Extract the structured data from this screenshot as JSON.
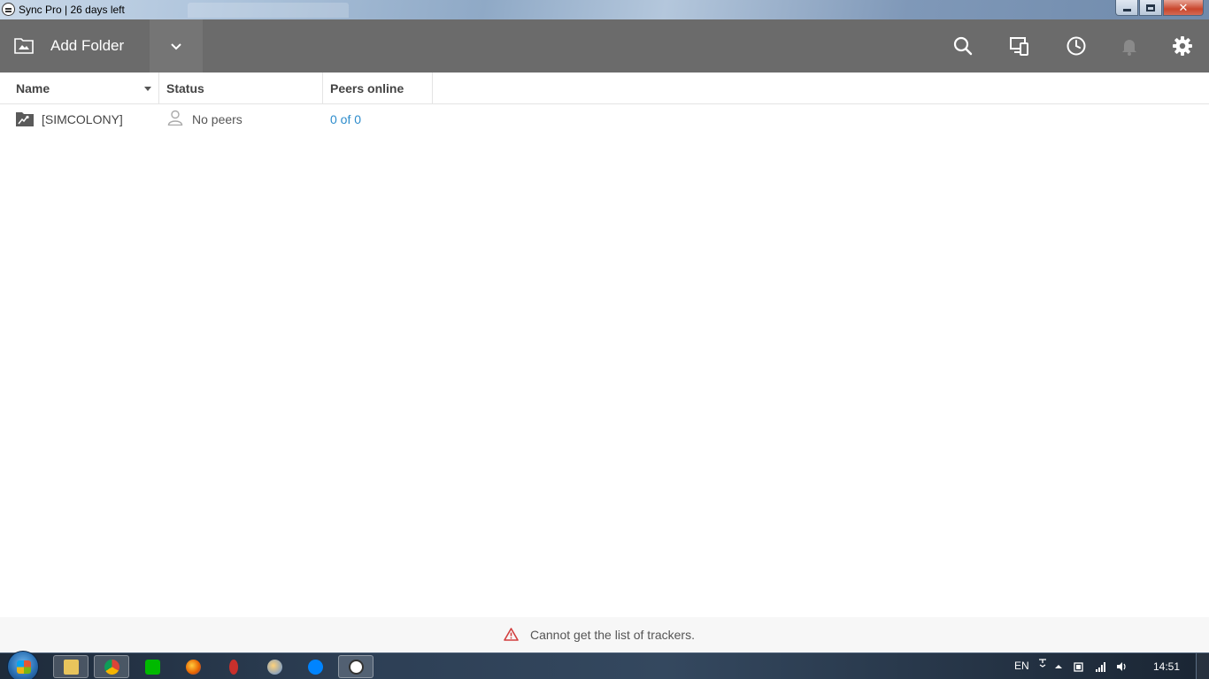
{
  "window": {
    "title": "Sync Pro | 26 days left"
  },
  "toolbar": {
    "add_folder_label": "Add Folder",
    "icons": [
      "search-icon",
      "devices-icon",
      "history-icon",
      "notifications-icon",
      "settings-icon"
    ]
  },
  "table": {
    "columns": [
      "Name",
      "Status",
      "Peers online"
    ],
    "sort_column": "Name",
    "rows": [
      {
        "name": "[SIMCOLONY]",
        "status": "No peers",
        "peers_online": "0 of 0"
      }
    ]
  },
  "statusbar": {
    "message": "Cannot get the list of trackers."
  },
  "taskbar": {
    "apps": [
      "file-explorer-icon",
      "chrome-icon",
      "chat-app-icon",
      "firefox-icon",
      "utility-app-icon",
      "browser-app-icon",
      "messenger-icon",
      "sync-app-icon"
    ],
    "language": "EN",
    "clock": "14:51"
  },
  "colors": {
    "toolbar_bg": "#6b6b6b",
    "link_blue": "#2d8ccc",
    "warning_red": "#d23f3f"
  }
}
